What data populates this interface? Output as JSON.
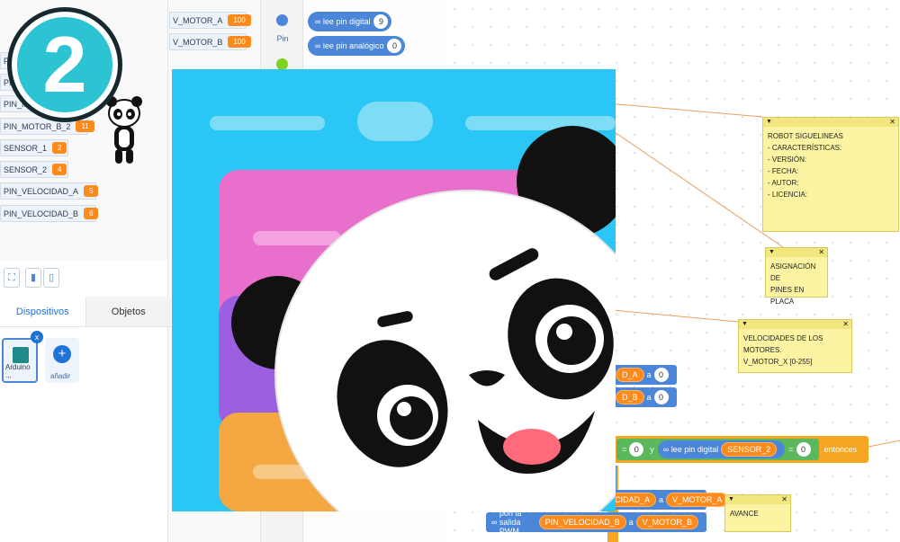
{
  "badge": {
    "number": "2"
  },
  "variables_left": [
    {
      "name": "PIN_",
      "value": ""
    },
    {
      "name": "PIN_",
      "value": ""
    },
    {
      "name": "PIN_MO",
      "value": ""
    },
    {
      "name": "PIN_MOTOR_B_2",
      "value": "11"
    },
    {
      "name": "SENSOR_1",
      "value": "2"
    },
    {
      "name": "SENSOR_2",
      "value": "4"
    },
    {
      "name": "PIN_VELOCIDAD_A",
      "value": "5"
    },
    {
      "name": "PIN_VELOCIDAD_B",
      "value": "6"
    }
  ],
  "variables_mid": [
    {
      "name": "V_MOTOR_A",
      "value": "100"
    },
    {
      "name": "V_MOTOR_B",
      "value": "100"
    }
  ],
  "category": {
    "label": "Pin",
    "colors": [
      "#4c86d8",
      "#7ed321"
    ]
  },
  "palette": {
    "block1": {
      "label": "lee pin digital",
      "value": "9"
    },
    "block2": {
      "label": "lee pin analógico",
      "value": "0"
    }
  },
  "tabs": {
    "devices": "Dispositivos",
    "objects": "Objetos"
  },
  "device": {
    "label": "Arduino ...",
    "close": "x"
  },
  "add": {
    "label": "añadir",
    "plus": "+"
  },
  "notes": {
    "note1": "ROBOT SIGUELINEAS\n- CARACTERÍSTICAS:\n- VERSIÓN:\n- FECHA:\n- AUTOR:\n- LICENCIA:",
    "note2": "ASIGNACIÓN DE\nPINES EN PLACA",
    "note3": "VELOCIDADES DE LOS MOTORES.\nV_MOTOR_X [0-255]",
    "note4": "AVANCE"
  },
  "workspace": {
    "row1": {
      "pill": "D_A",
      "a": "a",
      "num": "0"
    },
    "row2": {
      "pill": "D_B",
      "a": "a",
      "num": "0"
    },
    "cond": {
      "eq1": "=",
      "num1": "0",
      "and": "y",
      "read": "lee pin digital",
      "sensor": "SENSOR_2",
      "eq2": "=",
      "num2": "0",
      "then": "entonces"
    },
    "pwm1": {
      "pill": "CIDAD_A",
      "a": "a",
      "var": "V_MOTOR_A"
    },
    "pwm2": {
      "prefix": "pon la salida PWM",
      "pill": "PIN_VELOCIDAD_B",
      "a": "a",
      "var": "V_MOTOR_B"
    }
  },
  "colors": {
    "accent": "#1f73d6",
    "block_blue": "#4c86d8",
    "var_orange": "#ff8a1c",
    "cond_green": "#5cb85c",
    "cond_orange": "#f5a623",
    "note_yellow": "#fcf4a2",
    "overlay_bg": "#2ac6f6"
  }
}
